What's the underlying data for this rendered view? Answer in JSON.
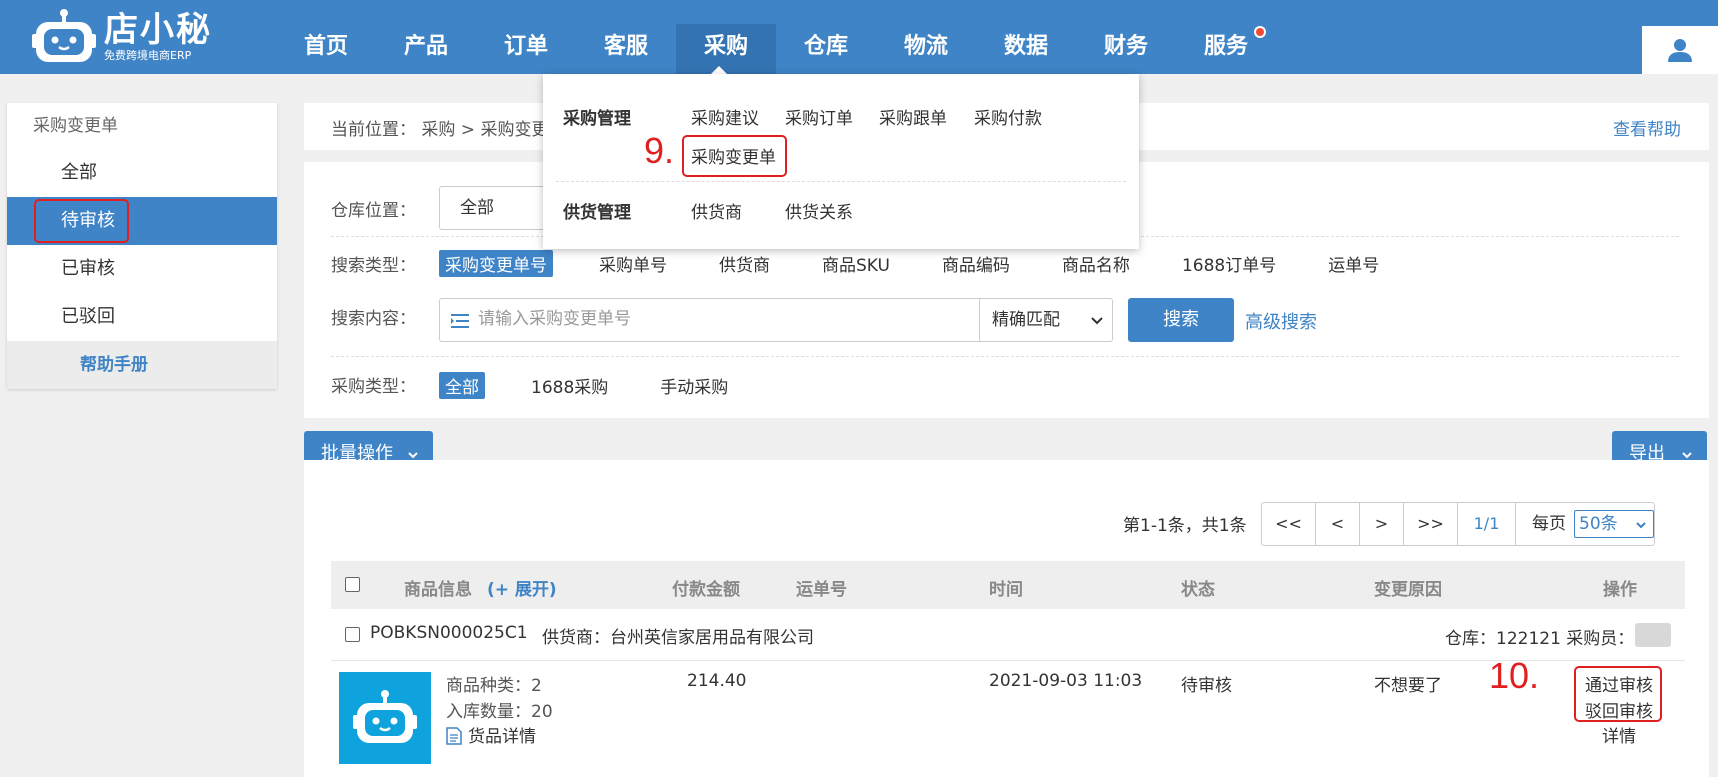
{
  "brand": {
    "name": "店小秘",
    "subtitle": "免费跨境电商ERP"
  },
  "nav": {
    "items": [
      {
        "label": "首页"
      },
      {
        "label": "产品"
      },
      {
        "label": "订单"
      },
      {
        "label": "客服"
      },
      {
        "label": "采购"
      },
      {
        "label": "仓库"
      },
      {
        "label": "物流"
      },
      {
        "label": "数据"
      },
      {
        "label": "财务"
      },
      {
        "label": "服务"
      }
    ],
    "active": "采购"
  },
  "dropdown": {
    "group1": {
      "title": "采购管理",
      "links": [
        "采购建议",
        "采购订单",
        "采购跟单",
        "采购付款"
      ],
      "highlight": "采购变更单"
    },
    "group2": {
      "title": "供货管理",
      "links": [
        "供货商",
        "供货关系"
      ]
    }
  },
  "annotations": {
    "step9": "9.",
    "step10": "10."
  },
  "sidebar": {
    "title": "采购变更单",
    "items": [
      "全部",
      "待审核",
      "已审核",
      "已驳回"
    ],
    "help": "帮助手册"
  },
  "breadcrumb": {
    "text": "当前位置： 采购 > 采购变更单",
    "help": "查看帮助"
  },
  "filters": {
    "warehouse_label": "仓库位置：",
    "warehouse_value": "全部",
    "search_type_label": "搜索类型：",
    "search_types": [
      "采购变更单号",
      "采购单号",
      "供货商",
      "商品SKU",
      "商品编码",
      "商品名称",
      "1688订单号",
      "运单号"
    ],
    "search_content_label": "搜索内容：",
    "search_placeholder": "请输入采购变更单号",
    "match_value": "精确匹配",
    "search_button": "搜索",
    "advanced": "高级搜索",
    "purchase_type_label": "采购类型：",
    "purchase_types": [
      "全部",
      "1688采购",
      "手动采购"
    ]
  },
  "toolbar": {
    "batch": "批量操作",
    "export": "导出"
  },
  "pagination": {
    "summary": "第1-1条，共1条",
    "buttons": [
      "<<",
      "<",
      ">",
      ">>",
      "1/1"
    ],
    "per_page_label": "每页",
    "per_page_value": "50条"
  },
  "table": {
    "columns": {
      "product": "商品信息",
      "expand": "(+ 展开)",
      "amount": "付款金额",
      "tracking": "运单号",
      "time": "时间",
      "status": "状态",
      "reason": "变更原因",
      "action": "操作"
    },
    "order": {
      "id": "POBKSN000025C1",
      "supplier": "供货商：台州英信家居用品有限公司",
      "warehouse": "仓库：122121 采购员："
    },
    "item": {
      "kinds": "商品种类：2",
      "quantity": "入库数量：20",
      "detail_link": "货品详情",
      "amount": "214.40",
      "time": "2021-09-03 11:03",
      "status": "待审核",
      "reason": "不想要了",
      "actions": [
        "通过审核",
        "驳回审核",
        "详情"
      ]
    }
  }
}
